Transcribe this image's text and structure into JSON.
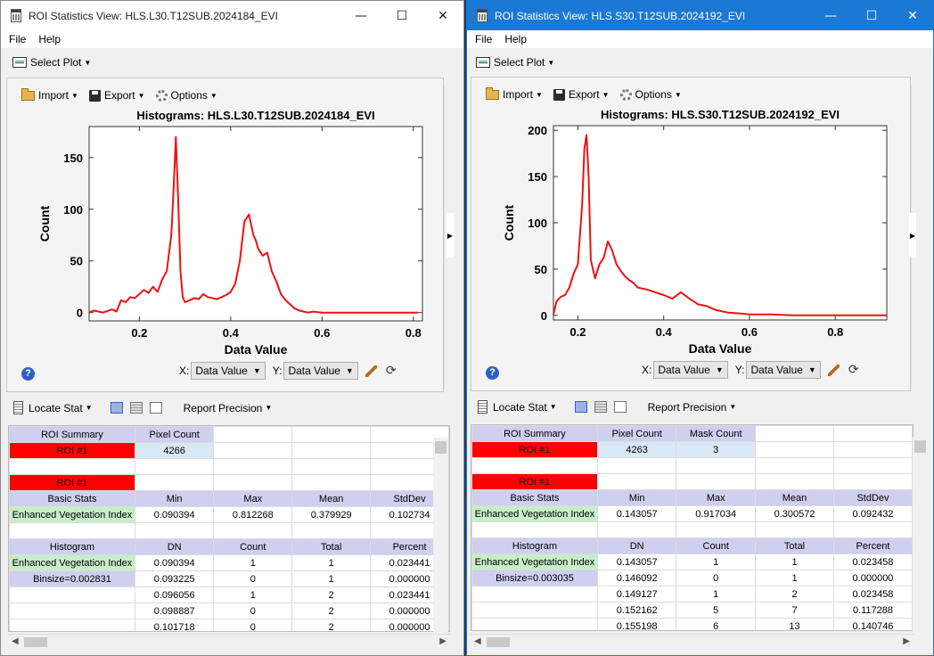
{
  "left": {
    "title": "ROI Statistics View: HLS.L30.T12SUB.2024184_EVI",
    "menu": [
      "File",
      "Help"
    ],
    "select_plot": "Select Plot",
    "plot_tools": {
      "import": "Import",
      "export": "Export",
      "options": "Options"
    },
    "x_label": "X:",
    "y_label": "Y:",
    "x_select": "Data Value",
    "y_select": "Data Value",
    "locate_stat": "Locate Stat",
    "report_precision": "Report Precision",
    "table": [
      [
        "ROI Summary",
        "Pixel Count",
        "",
        "",
        ""
      ],
      [
        "ROI #1",
        "4266",
        "",
        "",
        ""
      ],
      [
        "",
        "",
        "",
        "",
        ""
      ],
      [
        "ROI #1",
        "",
        "",
        "",
        ""
      ],
      [
        "Basic Stats",
        "Min",
        "Max",
        "Mean",
        "StdDev"
      ],
      [
        "Enhanced Vegetation Index",
        "0.090394",
        "0.812268",
        "0.379929",
        "0.102734"
      ],
      [
        "",
        "",
        "",
        "",
        ""
      ],
      [
        "Histogram",
        "DN",
        "Count",
        "Total",
        "Percent"
      ],
      [
        "Enhanced Vegetation Index",
        "0.090394",
        "1",
        "1",
        "0.023441"
      ],
      [
        "Binsize=0.002831",
        "0.093225",
        "0",
        "1",
        "0.000000"
      ],
      [
        "",
        "0.096056",
        "1",
        "2",
        "0.023441"
      ],
      [
        "",
        "0.098887",
        "0",
        "2",
        "0.000000"
      ],
      [
        "",
        "0.101718",
        "0",
        "2",
        "0.000000"
      ]
    ]
  },
  "right": {
    "title": "ROI Statistics View: HLS.S30.T12SUB.2024192_EVI",
    "menu": [
      "File",
      "Help"
    ],
    "select_plot": "Select Plot",
    "plot_tools": {
      "import": "Import",
      "export": "Export",
      "options": "Options"
    },
    "x_label": "X:",
    "y_label": "Y:",
    "x_select": "Data Value",
    "y_select": "Data Value",
    "locate_stat": "Locate Stat",
    "report_precision": "Report Precision",
    "table": [
      [
        "ROI Summary",
        "Pixel Count",
        "Mask Count",
        "",
        ""
      ],
      [
        "ROI #1",
        "4263",
        "3",
        "",
        ""
      ],
      [
        "",
        "",
        "",
        "",
        ""
      ],
      [
        "ROI #1",
        "",
        "",
        "",
        ""
      ],
      [
        "Basic Stats",
        "Min",
        "Max",
        "Mean",
        "StdDev"
      ],
      [
        "Enhanced Vegetation Index",
        "0.143057",
        "0.917034",
        "0.300572",
        "0.092432"
      ],
      [
        "",
        "",
        "",
        "",
        ""
      ],
      [
        "Histogram",
        "DN",
        "Count",
        "Total",
        "Percent"
      ],
      [
        "Enhanced Vegetation Index",
        "0.143057",
        "1",
        "1",
        "0.023458"
      ],
      [
        "Binsize=0.003035",
        "0.146092",
        "0",
        "1",
        "0.000000"
      ],
      [
        "",
        "0.149127",
        "1",
        "2",
        "0.023458"
      ],
      [
        "",
        "0.152162",
        "5",
        "7",
        "0.117288"
      ],
      [
        "",
        "0.155198",
        "6",
        "13",
        "0.140746"
      ]
    ]
  },
  "chart_data": [
    {
      "type": "line",
      "title": "Histograms: HLS.L30.T12SUB.2024184_EVI",
      "xlabel": "Data Value",
      "ylabel": "Count",
      "xlim": [
        0.09,
        0.82
      ],
      "ylim": [
        -8,
        180
      ],
      "xticks": [
        0.2,
        0.4,
        0.6,
        0.8
      ],
      "yticks": [
        0,
        50,
        100,
        150
      ],
      "color": "#ee1111",
      "x": [
        0.09,
        0.1,
        0.12,
        0.14,
        0.15,
        0.16,
        0.17,
        0.18,
        0.19,
        0.2,
        0.21,
        0.22,
        0.23,
        0.24,
        0.25,
        0.26,
        0.27,
        0.275,
        0.28,
        0.285,
        0.29,
        0.295,
        0.3,
        0.31,
        0.32,
        0.33,
        0.34,
        0.35,
        0.36,
        0.37,
        0.38,
        0.39,
        0.4,
        0.41,
        0.42,
        0.43,
        0.44,
        0.45,
        0.455,
        0.46,
        0.47,
        0.48,
        0.49,
        0.5,
        0.51,
        0.52,
        0.53,
        0.54,
        0.55,
        0.56,
        0.57,
        0.58,
        0.6,
        0.65,
        0.7,
        0.75,
        0.8,
        0.81
      ],
      "y": [
        0,
        2,
        0,
        3,
        1,
        12,
        10,
        15,
        14,
        18,
        22,
        19,
        25,
        20,
        32,
        40,
        75,
        120,
        170,
        110,
        40,
        15,
        10,
        12,
        14,
        13,
        18,
        15,
        14,
        13,
        15,
        17,
        20,
        28,
        50,
        88,
        95,
        75,
        70,
        62,
        55,
        58,
        40,
        30,
        18,
        12,
        8,
        4,
        2,
        1,
        0,
        1,
        0,
        0,
        0,
        0,
        0,
        0
      ]
    },
    {
      "type": "line",
      "title": "Histograms: HLS.S30.T12SUB.2024192_EVI",
      "xlabel": "Data Value",
      "ylabel": "Count",
      "xlim": [
        0.143,
        0.92
      ],
      "ylim": [
        -5,
        205
      ],
      "xticks": [
        0.2,
        0.4,
        0.6,
        0.8
      ],
      "yticks": [
        0,
        50,
        100,
        150,
        200
      ],
      "color": "#ee1111",
      "x": [
        0.143,
        0.15,
        0.16,
        0.17,
        0.18,
        0.19,
        0.2,
        0.21,
        0.215,
        0.22,
        0.225,
        0.23,
        0.24,
        0.25,
        0.26,
        0.27,
        0.28,
        0.29,
        0.3,
        0.31,
        0.32,
        0.33,
        0.34,
        0.36,
        0.38,
        0.4,
        0.42,
        0.44,
        0.46,
        0.48,
        0.5,
        0.52,
        0.55,
        0.58,
        0.6,
        0.65,
        0.7,
        0.8,
        0.9,
        0.92
      ],
      "y": [
        1,
        15,
        20,
        22,
        30,
        45,
        55,
        120,
        180,
        195,
        150,
        60,
        40,
        55,
        62,
        80,
        70,
        55,
        48,
        42,
        38,
        35,
        30,
        28,
        25,
        22,
        18,
        25,
        18,
        12,
        10,
        6,
        3,
        2,
        1,
        1,
        0,
        0,
        0,
        0
      ]
    }
  ]
}
